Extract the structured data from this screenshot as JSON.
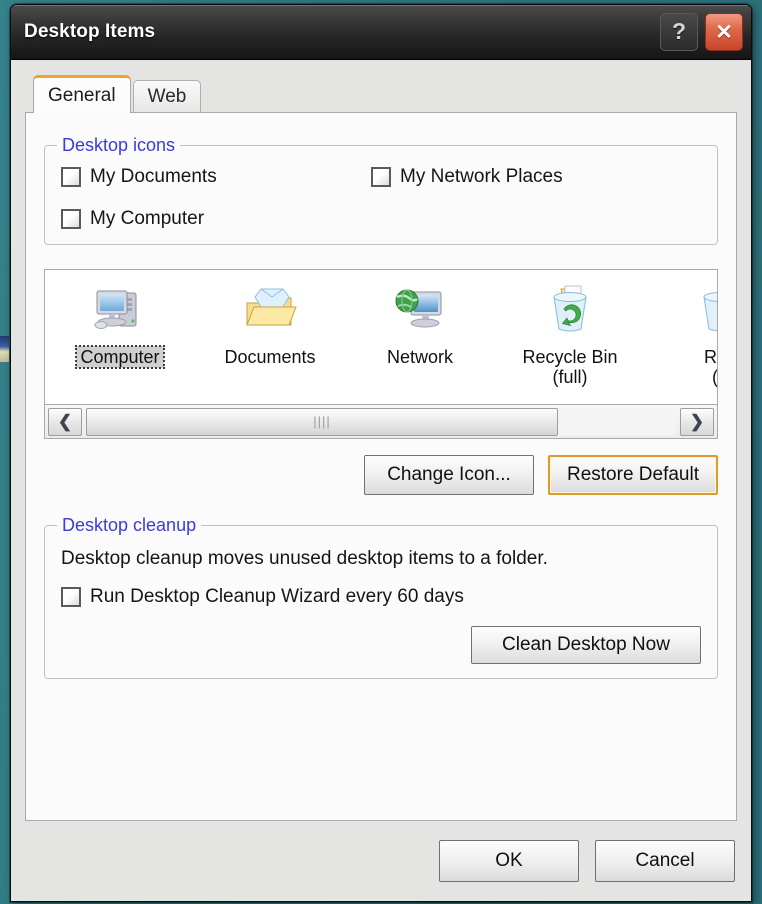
{
  "window": {
    "title": "Desktop Items",
    "help_button": "?",
    "close_button": "✕"
  },
  "tabs": [
    {
      "label": "General",
      "active": true
    },
    {
      "label": "Web",
      "active": false
    }
  ],
  "desktop_icons_group": {
    "legend": "Desktop icons",
    "checkboxes_left": [
      {
        "label": "My Documents",
        "checked": false
      },
      {
        "label": "My Computer",
        "checked": false
      }
    ],
    "checkboxes_right": [
      {
        "label": "My Network Places",
        "checked": false
      }
    ]
  },
  "icon_preview": {
    "items": [
      {
        "label": "Computer",
        "sublabel": "",
        "icon": "computer-icon",
        "selected": true
      },
      {
        "label": "Documents",
        "sublabel": "",
        "icon": "documents-folder-icon",
        "selected": false
      },
      {
        "label": "Network",
        "sublabel": "",
        "icon": "network-icon",
        "selected": false
      },
      {
        "label": "Recycle Bin",
        "sublabel": "(full)",
        "icon": "recycle-bin-full-icon",
        "selected": false
      },
      {
        "label": "Rec",
        "sublabel": "(e",
        "icon": "recycle-bin-empty-icon",
        "selected": false
      }
    ],
    "scrollbar": {
      "left_arrow": "❮",
      "right_arrow": "❯",
      "grip": "||||"
    }
  },
  "icon_buttons": {
    "change_icon": "Change Icon...",
    "restore_default": "Restore Default"
  },
  "cleanup_group": {
    "legend": "Desktop cleanup",
    "description": "Desktop cleanup moves unused desktop items to a folder.",
    "checkbox": {
      "label": "Run Desktop Cleanup Wizard every 60 days",
      "checked": false
    },
    "clean_now": "Clean Desktop Now"
  },
  "footer": {
    "ok": "OK",
    "cancel": "Cancel"
  },
  "colors": {
    "accent_focus": "#e09a2a",
    "legend_text": "#3a3ae0",
    "titlebar_dark": "#272727",
    "close_red": "#c8442a",
    "desktop_teal": "#2f7e84"
  }
}
